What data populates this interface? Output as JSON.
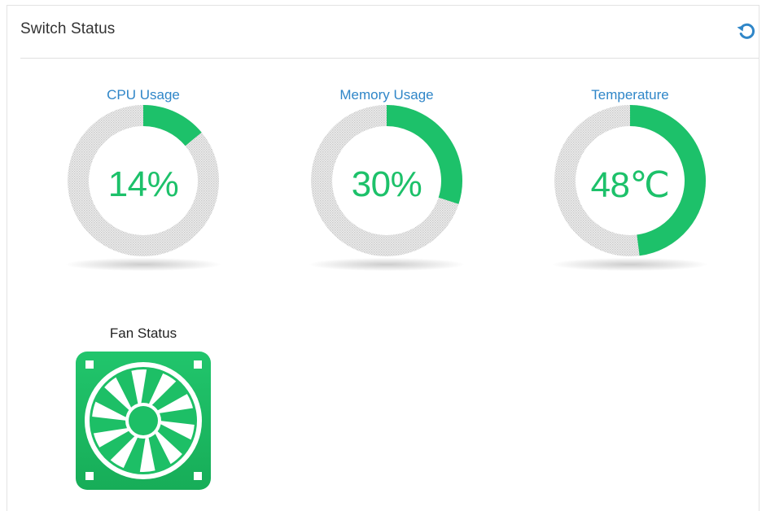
{
  "header": {
    "title": "Switch Status",
    "refresh_icon": "refresh-icon"
  },
  "colors": {
    "accent_blue": "#2f86c8",
    "gauge_fill": "#1dc16a",
    "gauge_track": "#d6d6d6",
    "fan_green": "#1dbf66"
  },
  "gauges": [
    {
      "label": "CPU Usage",
      "value_text": "14%",
      "fraction": 0.14
    },
    {
      "label": "Memory Usage",
      "value_text": "30%",
      "fraction": 0.3
    },
    {
      "label": "Temperature",
      "value_text": "48℃",
      "fraction": 0.48
    }
  ],
  "fan": {
    "label": "Fan Status",
    "icon": "fan-icon"
  }
}
